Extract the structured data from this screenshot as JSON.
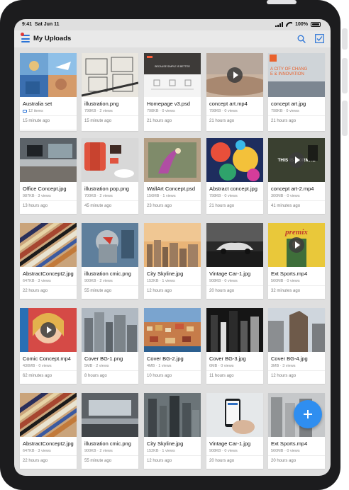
{
  "status_bar": {
    "time": "9:41",
    "date": "Sat Jun 11",
    "battery": "100%"
  },
  "header": {
    "title": "My Uploads",
    "accent_color": "#2a73d6",
    "notification_dot_color": "#e53935"
  },
  "items": [
    {
      "name": "Australia set",
      "meta": "12 items",
      "time": "15 minute ago",
      "type": "folder",
      "thumb": "australia"
    },
    {
      "name": "illustration.png",
      "meta": "798KB · 2 views",
      "time": "15 minute ago",
      "type": "image",
      "thumb": "sketch"
    },
    {
      "name": "Homepage v3.psd",
      "meta": "798KB · 0 views",
      "time": "21 hours ago",
      "type": "image",
      "thumb": "homepage"
    },
    {
      "name": "concept art.mp4",
      "meta": "798KB · 0 views",
      "time": "21 hours ago",
      "type": "video",
      "thumb": "desert"
    },
    {
      "name": "concept art.jpg",
      "meta": "798KB · 0 views",
      "time": "21 hours ago",
      "type": "image",
      "thumb": "city_poster"
    },
    {
      "name": "Office Concept.jpg",
      "meta": "987KB · 3 views",
      "time": "13 hours ago",
      "type": "image",
      "thumb": "office"
    },
    {
      "name": "illustration pop.png",
      "meta": "700KB · 2 views",
      "time": "45 minute ago",
      "type": "image",
      "thumb": "popart"
    },
    {
      "name": "WallArt Concept.psd",
      "meta": "156MB · 1 views",
      "time": "23 hours ago",
      "type": "image",
      "thumb": "wallart"
    },
    {
      "name": "Abstract concept.jpg",
      "meta": "798KB · 0 views",
      "time": "21 hours ago",
      "type": "image",
      "thumb": "abstract"
    },
    {
      "name": "concept art-2.mp4",
      "meta": "300MB · 0 views",
      "time": "41 minutes ago",
      "type": "video",
      "thumb": "normal"
    },
    {
      "name": "AbstractConcept2.jpg",
      "meta": "647KB · 3 views",
      "time": "22 hours ago",
      "type": "image",
      "thumb": "stripes"
    },
    {
      "name": "illustration cmic.png",
      "meta": "900KB · 2 views",
      "time": "55 minute ago",
      "type": "image",
      "thumb": "comic"
    },
    {
      "name": "City Skyline.jpg",
      "meta": "152KB · 1 views",
      "time": "12 hours ago",
      "type": "image",
      "thumb": "skyline"
    },
    {
      "name": "Vintage Car-1.jpg",
      "meta": "908KB · 0 views",
      "time": "20 hours ago",
      "type": "image",
      "thumb": "car"
    },
    {
      "name": "Ext Sports.mp4",
      "meta": "560MB · 0 views",
      "time": "32 minutes ago",
      "type": "video",
      "thumb": "sports"
    },
    {
      "name": "Comic Concept.mp4",
      "meta": "430MB · 0 views",
      "time": "62 minutes ago",
      "type": "video",
      "thumb": "comic_girl"
    },
    {
      "name": "Cover BG-1.png",
      "meta": "5MB · 2 views",
      "time": "8 hours ago",
      "type": "image",
      "thumb": "buildings"
    },
    {
      "name": "Cover BG-2.jpg",
      "meta": "4MB · 1 views",
      "time": "10 hours ago",
      "type": "image",
      "thumb": "cliff_town"
    },
    {
      "name": "Cover BG-3.jpg",
      "meta": "6MB · 0 views",
      "time": "11 hours ago",
      "type": "image",
      "thumb": "bw_city"
    },
    {
      "name": "Cover BG-4.jpg",
      "meta": "3MB · 3 views",
      "time": "12 hours ago",
      "type": "image",
      "thumb": "flatiron"
    },
    {
      "name": "AbstractConcept2.jpg",
      "meta": "647KB · 3 views",
      "time": "22 hours ago",
      "type": "image",
      "thumb": "stripes"
    },
    {
      "name": "illustration cmic.png",
      "meta": "900KB · 2 views",
      "time": "55 minute ago",
      "type": "image",
      "thumb": "apple_store"
    },
    {
      "name": "City Skyline.jpg",
      "meta": "152KB · 1 views",
      "time": "12 hours ago",
      "type": "image",
      "thumb": "aerial"
    },
    {
      "name": "Vintage Car-1.jpg",
      "meta": "908KB · 0 views",
      "time": "20 hours ago",
      "type": "image",
      "thumb": "phone"
    },
    {
      "name": "Ext Sports.mp4",
      "meta": "560MB · 0 views",
      "time": "20 hours ago",
      "type": "image",
      "thumb": "street_gray"
    }
  ],
  "homepage_thumb_caption": "BECAUSE SIMPLE IS BETTER",
  "city_poster_caption": "A CITY OF CHANGE & INNOVATION",
  "normal_caption": "THIS IS NORMAL",
  "sports_caption": "premix",
  "fab": {
    "icon": "plus-icon",
    "color": "#2f8ef0"
  }
}
